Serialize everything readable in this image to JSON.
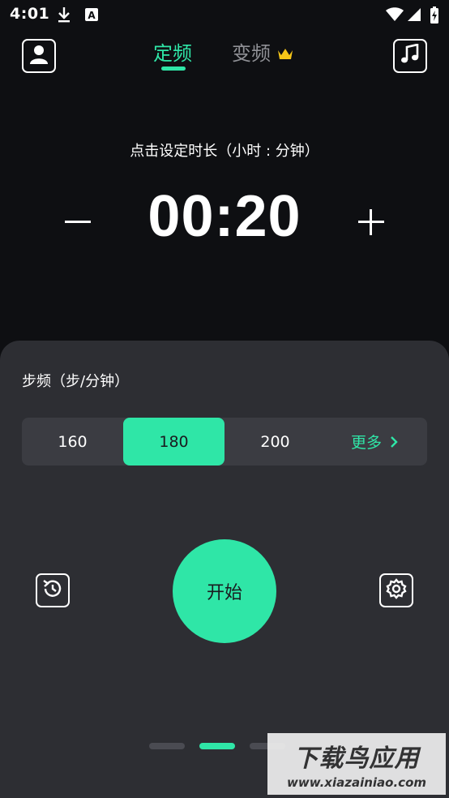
{
  "status_bar": {
    "time": "4:01",
    "icons": [
      "download-icon",
      "a-badge-icon",
      "wifi-icon",
      "signal-icon",
      "battery-icon"
    ]
  },
  "header": {
    "tabs": [
      {
        "label": "定频",
        "active": true
      },
      {
        "label": "变频",
        "active": false,
        "badge_icon": "crown-icon"
      }
    ],
    "left_icon": "user-icon",
    "right_icon": "music-note-icon"
  },
  "timer": {
    "hint": "点击设定时长（小时 : 分钟）",
    "value": "00:20",
    "decrement_icon": "minus-icon",
    "increment_icon": "plus-icon"
  },
  "cadence_panel": {
    "title": "步频（步/分钟）",
    "options": [
      "160",
      "180",
      "200"
    ],
    "selected": "180",
    "more_label": "更多",
    "start_label": "开始",
    "history_icon": "history-icon",
    "settings_icon": "settings-gear-icon"
  },
  "pager": {
    "count": 3,
    "active_index": 1
  },
  "watermark": {
    "title": "下载鸟应用",
    "url": "www.xiazainiao.com"
  },
  "colors": {
    "accent": "#2fe6a7",
    "background": "#0e0f12",
    "panel": "#2d2e33",
    "segmented_bg": "#3b3c42",
    "inactive_tab": "#8f9095"
  }
}
